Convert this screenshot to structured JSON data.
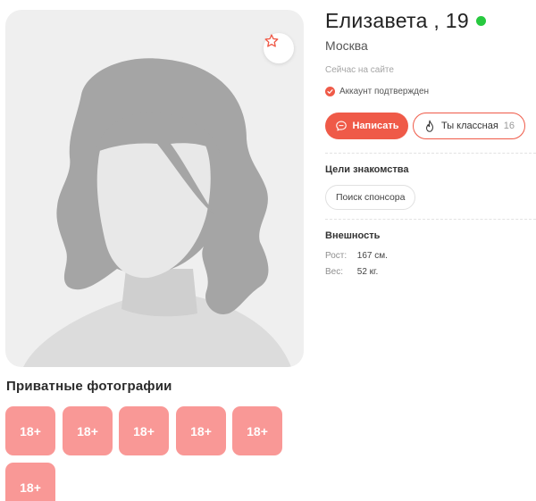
{
  "profile": {
    "name": "Елизавета , 19",
    "city": "Москва",
    "status": "Сейчас на сайте",
    "verified": "Аккаунт подтвержден"
  },
  "actions": {
    "write_label": "Написать",
    "like_label": "Ты классная",
    "like_count": "16"
  },
  "goals": {
    "title": "Цели знакомства",
    "items": [
      "Поиск спонсора"
    ]
  },
  "appearance": {
    "title": "Внешность",
    "height_label": "Рост:",
    "height_value": "167 см.",
    "weight_label": "Вес:",
    "weight_value": "52 кг."
  },
  "private_photos": {
    "title": "Приватные фотографии",
    "tiles": [
      "18+",
      "18+",
      "18+",
      "18+",
      "18+",
      "18+"
    ]
  },
  "colors": {
    "accent": "#ef5a48",
    "online": "#27c93f",
    "tile": "#f99896"
  },
  "icons": {
    "favorite": "star-icon",
    "write": "chat-bubble-icon",
    "like": "flame-icon",
    "verified": "check-circle-icon"
  }
}
